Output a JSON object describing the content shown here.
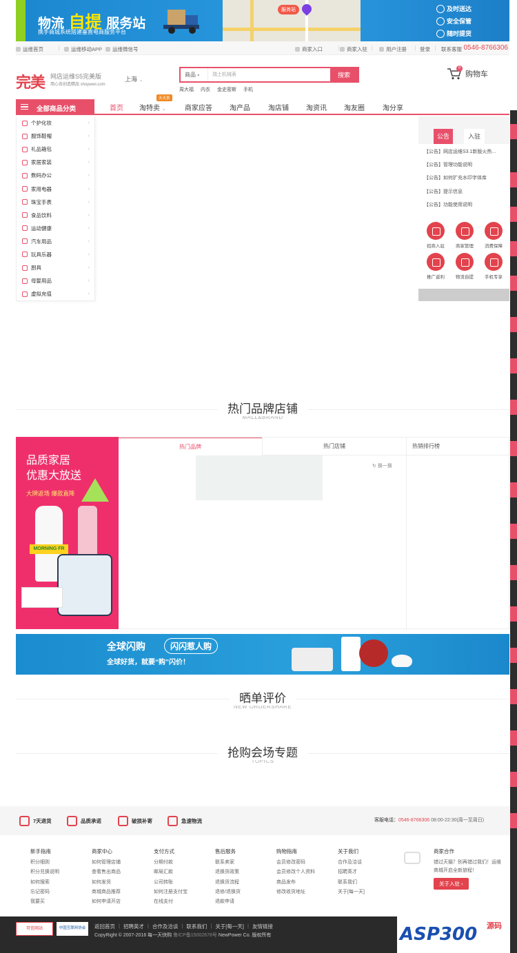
{
  "banner": {
    "title_a": "物流",
    "title_b": "自提",
    "title_c": "服务站",
    "subtitle": "携手商城系统搭建垂直电商服务平台",
    "map_tag": "服务站",
    "badges": [
      "及时送达",
      "安全保管",
      "随时提货"
    ]
  },
  "topnav": {
    "left": [
      "运维首页",
      "运维移动APP",
      "运维微信号"
    ],
    "right": [
      "商家入口",
      "商家入驻",
      "用户注册",
      "登录",
      "联系客服"
    ],
    "phone": "0546-8766306"
  },
  "header": {
    "logo": "完美",
    "logo_sub1": "网店运维S5完美版",
    "logo_sub2": "用心去创造精品 shopwwi.com",
    "city": "上海",
    "search_type": "商品",
    "search_placeholder": "瑞士机械表",
    "search_button": "搜索",
    "hot_words": [
      "周大福",
      "内衣",
      "金史密斯",
      "手机"
    ],
    "cart_label": "购物车",
    "cart_count": "0"
  },
  "mainnav": {
    "all_categories": "全部商品分类",
    "hot_tag": "天天卖",
    "links": [
      "首页",
      "淘特卖",
      "商家应答",
      "淘产品",
      "淘店铺",
      "淘资讯",
      "淘友圈",
      "淘分享"
    ]
  },
  "categories": [
    "个护化妆",
    "服饰鞋帽",
    "礼品箱包",
    "家居家装",
    "数码办公",
    "家用电器",
    "珠宝手表",
    "食品饮料",
    "运动健康",
    "汽车用品",
    "玩具乐器",
    "厨具",
    "母婴用品",
    "虚拟充值"
  ],
  "notice": {
    "tab_active": "公告",
    "tab_other": "入驻",
    "items": [
      "【公告】网店运维S3.1新版火热...",
      "【公告】管理功能说明",
      "【公告】如何扩充水印字体库",
      "【公告】提示信息",
      "【公告】功能使用说明"
    ],
    "services": [
      "招商入驻",
      "商家管理",
      "消费保障",
      "推广返利",
      "物流自提",
      "手机专享"
    ]
  },
  "sections": {
    "brand_cn": "热门品牌店铺",
    "brand_en": "MALL&BRAND",
    "share_cn": "晒单评价",
    "share_en": "NEW ORDERSHARE",
    "topic_cn": "抢购会场专题",
    "topic_en": "TOPICS"
  },
  "brand": {
    "promo_line1": "品质家居",
    "promo_line2": "优惠大放送",
    "promo_line3": "大牌返场 爆款直降",
    "tab1": "热门品牌",
    "tab2": "热门店铺",
    "tab3": "热销排行榜",
    "refresh": "换一换"
  },
  "flash": {
    "title": "全球闪购",
    "tag": "闪闪惹人购",
    "subtitle": "全球好货，就要“购”闪价！"
  },
  "promises": [
    "7天退货",
    "品质承诺",
    "破损补寄",
    "急速物流"
  ],
  "hotline": {
    "label": "客服电话：",
    "number": "0546-8766306",
    "hours": "08:00-22:30(周一至周日)"
  },
  "footer_cols": [
    {
      "title": "新手指南",
      "links": [
        "积分细则",
        "积分兑换说明",
        "如何搜索",
        "忘记密码",
        "我要买"
      ]
    },
    {
      "title": "商家中心",
      "links": [
        "如何管理店铺",
        "查看售出商品",
        "如何发货",
        "商城商品推荐",
        "如何申请开店"
      ]
    },
    {
      "title": "支付方式",
      "links": [
        "分期付款",
        "邮局汇款",
        "公司转账",
        "如何注册支付宝",
        "在线支付"
      ]
    },
    {
      "title": "售后服务",
      "links": [
        "联系卖家",
        "退换货政策",
        "退换货流程",
        "退修/退换货",
        "退款申请"
      ]
    },
    {
      "title": "购物指南",
      "links": [
        "会员修改密码",
        "会员修改个人资料",
        "商品发布",
        "修改收货地址"
      ]
    },
    {
      "title": "关于我们",
      "links": [
        "合作及洽谈",
        "招聘英才",
        "联系我们",
        "关于[每一天]"
      ]
    }
  ],
  "partner": {
    "title": "商家合作",
    "desc": "错过天猫？别再错过我们！运维商城开启全新旅程！",
    "button": "关于入驻 ›"
  },
  "bottom": {
    "cert1": "可信网站",
    "cert2": "中国互联网协会",
    "links": [
      "返回首页",
      "招聘英才",
      "合作及洽谈",
      "联系我们",
      "关于[每一天]",
      "友情链接"
    ],
    "copyright": "CopyRight © 2007-2016 每一天快购",
    "icp": "鲁ICP备15002678号",
    "company": "NewPower Co. 版权所有"
  },
  "watermark": {
    "text": "ASP300",
    "suffix": "源码"
  }
}
